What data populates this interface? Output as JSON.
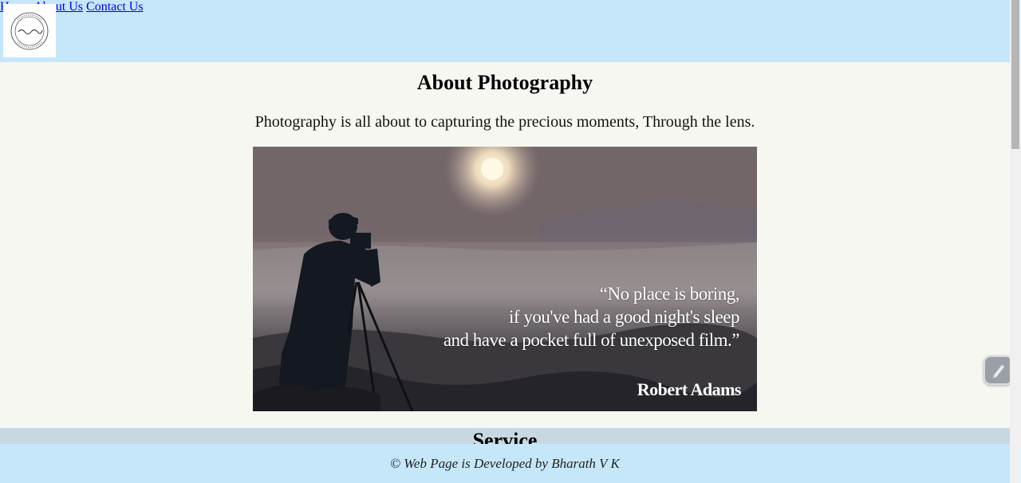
{
  "header": {
    "logo_alt": "logo",
    "nav": [
      {
        "label": "Home"
      },
      {
        "label": "About  Us"
      },
      {
        "label": "Contact  Us"
      }
    ]
  },
  "main": {
    "title": "About Photography",
    "lead": "Photography is all about to capturing the precious moments, Through the lens.",
    "image": {
      "quote_lines": [
        "“No place is boring,",
        "if you've had a good night's sleep",
        "and have a pocket full of unexposed film.”"
      ],
      "author": "Robert Adams"
    }
  },
  "service": {
    "title": "Service"
  },
  "footer": {
    "text": "© Web Page is Developed by Bharath V K"
  },
  "colors": {
    "header_bg": "#c5e7f9",
    "page_bg": "#f7f7f2",
    "nav_text": "#4a3a6e",
    "service_bg": "#c8d8e2",
    "footer_bg": "#c5e7f9"
  },
  "icons": {
    "widget": "pen-icon",
    "logo": "circular-stamp-logo"
  }
}
